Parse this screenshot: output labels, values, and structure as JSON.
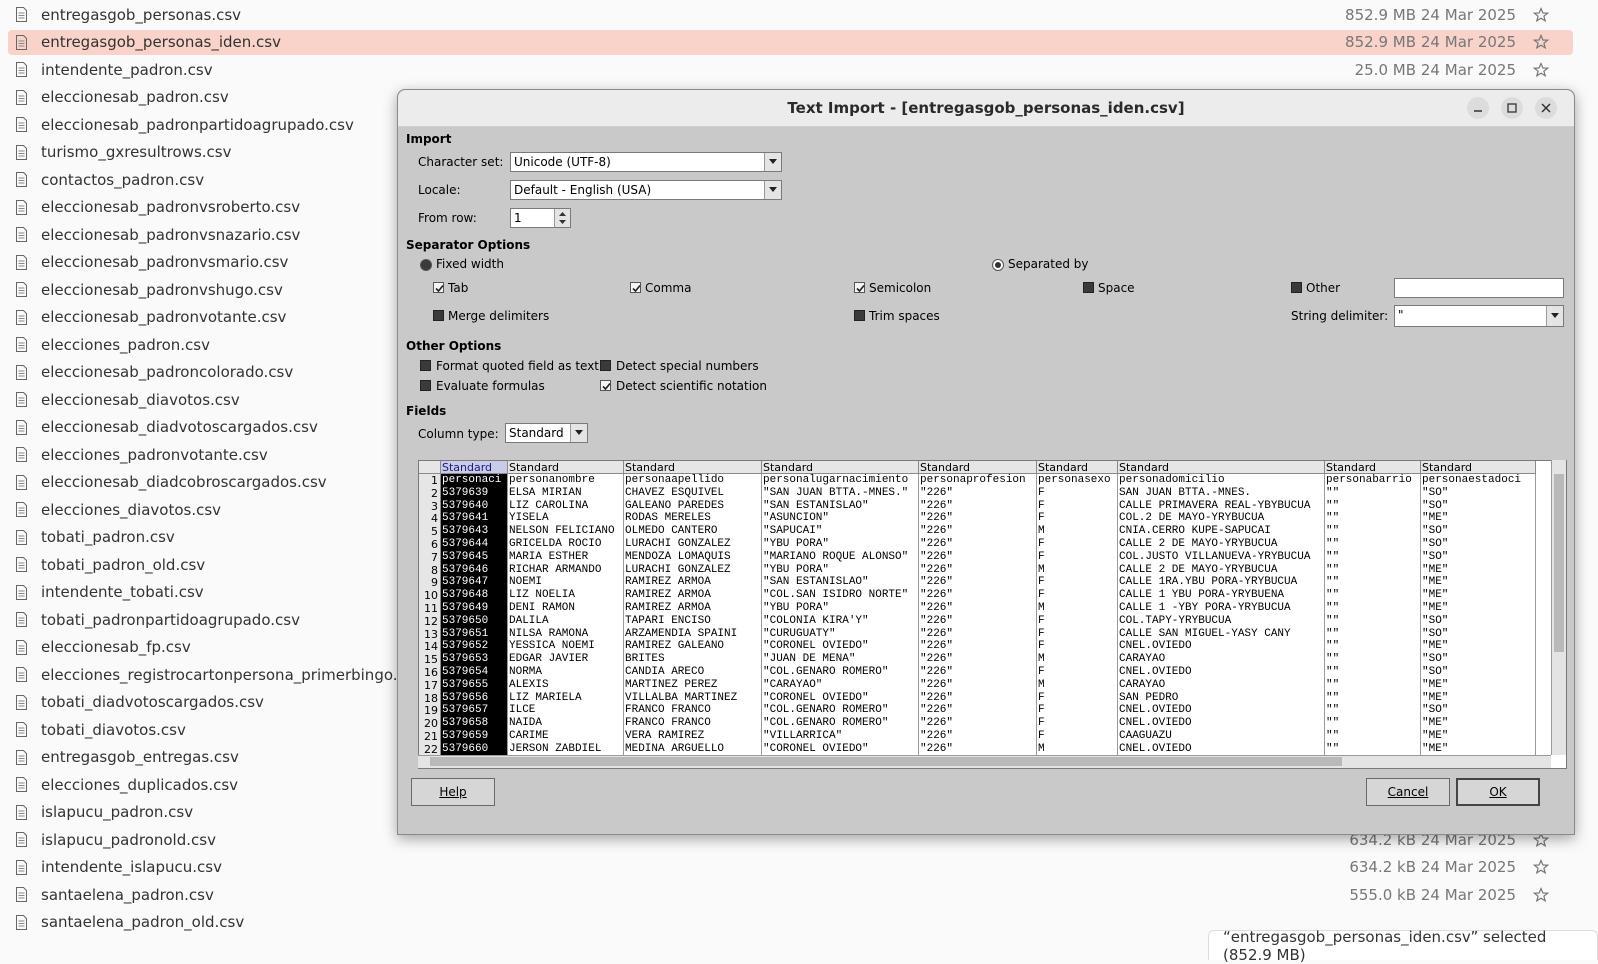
{
  "files": [
    {
      "name": "entregasgob_personas.csv",
      "size": "852.9 MB",
      "date": "24 Mar 2025"
    },
    {
      "name": "entregasgob_personas_iden.csv",
      "size": "852.9 MB",
      "date": "24 Mar 2025",
      "selected": true
    },
    {
      "name": "intendente_padron.csv",
      "size": "25.0 MB",
      "date": "24 Mar 2025"
    },
    {
      "name": "eleccionesab_padron.csv",
      "size": "",
      "date": ""
    },
    {
      "name": "eleccionesab_padronpartidoagrupado.csv",
      "size": "",
      "date": ""
    },
    {
      "name": "turismo_gxresultrows.csv",
      "size": "",
      "date": ""
    },
    {
      "name": "contactos_padron.csv",
      "size": "",
      "date": ""
    },
    {
      "name": "eleccionesab_padronvsroberto.csv",
      "size": "",
      "date": ""
    },
    {
      "name": "eleccionesab_padronvsnazario.csv",
      "size": "",
      "date": ""
    },
    {
      "name": "eleccionesab_padronvsmario.csv",
      "size": "",
      "date": ""
    },
    {
      "name": "eleccionesab_padronvshugo.csv",
      "size": "",
      "date": ""
    },
    {
      "name": "eleccionesab_padronvotante.csv",
      "size": "",
      "date": ""
    },
    {
      "name": "elecciones_padron.csv",
      "size": "",
      "date": ""
    },
    {
      "name": "eleccionesab_padroncolorado.csv",
      "size": "",
      "date": ""
    },
    {
      "name": "eleccionesab_diavotos.csv",
      "size": "",
      "date": ""
    },
    {
      "name": "eleccionesab_diadvotoscargados.csv",
      "size": "",
      "date": ""
    },
    {
      "name": "elecciones_padronvotante.csv",
      "size": "",
      "date": ""
    },
    {
      "name": "eleccionesab_diadcobroscargados.csv",
      "size": "",
      "date": ""
    },
    {
      "name": "elecciones_diavotos.csv",
      "size": "",
      "date": ""
    },
    {
      "name": "tobati_padron.csv",
      "size": "",
      "date": ""
    },
    {
      "name": "tobati_padron_old.csv",
      "size": "",
      "date": ""
    },
    {
      "name": "intendente_tobati.csv",
      "size": "",
      "date": ""
    },
    {
      "name": "tobati_padronpartidoagrupado.csv",
      "size": "",
      "date": ""
    },
    {
      "name": "eleccionesab_fp.csv",
      "size": "",
      "date": ""
    },
    {
      "name": "elecciones_registrocartonpersona_primerbingo.csv",
      "size": "",
      "date": ""
    },
    {
      "name": "tobati_diadvotoscargados.csv",
      "size": "",
      "date": ""
    },
    {
      "name": "tobati_diavotos.csv",
      "size": "",
      "date": ""
    },
    {
      "name": "entregasgob_entregas.csv",
      "size": "",
      "date": ""
    },
    {
      "name": "elecciones_duplicados.csv",
      "size": "",
      "date": ""
    },
    {
      "name": "islapucu_padron.csv",
      "size": "",
      "date": ""
    },
    {
      "name": "islapucu_padronold.csv",
      "size": "634.2 kB",
      "date": "24 Mar 2025"
    },
    {
      "name": "intendente_islapucu.csv",
      "size": "634.2 kB",
      "date": "24 Mar 2025"
    },
    {
      "name": "santaelena_padron.csv",
      "size": "555.0 kB",
      "date": "24 Mar 2025"
    },
    {
      "name": "santaelena_padron_old.csv",
      "size": "",
      "date": ""
    }
  ],
  "toast": "“entregasgob_personas_iden.csv” selected  (852.9 MB)",
  "dialog": {
    "title": "Text Import - [entregasgob_personas_iden.csv]",
    "import_section": "Import",
    "charset_label": "Character set:",
    "charset_value": "Unicode (UTF-8)",
    "locale_label": "Locale:",
    "locale_value": "Default - English (USA)",
    "fromrow_label": "From row:",
    "fromrow_value": "1",
    "separator_section": "Separator Options",
    "fixed_width": "Fixed width",
    "separated_by": "Separated by",
    "tab": "Tab",
    "comma": "Comma",
    "semicolon": "Semicolon",
    "space": "Space",
    "other": "Other",
    "merge_delimiters": "Merge delimiters",
    "trim_spaces": "Trim spaces",
    "string_delimiter_label": "String delimiter:",
    "string_delimiter_value": "\"",
    "other_section": "Other Options",
    "format_quoted": "Format quoted field as text",
    "detect_special": "Detect special numbers",
    "evaluate_formulas": "Evaluate formulas",
    "detect_scientific": "Detect scientific notation",
    "fields_section": "Fields",
    "column_type_label": "Column type:",
    "column_type_value": "Standard",
    "help": "Help",
    "cancel": "Cancel",
    "ok": "OK"
  },
  "preview": {
    "headers": [
      "Standard",
      "Standard",
      "Standard",
      "Standard",
      "Standard",
      "Standard",
      "Standard",
      "Standard",
      "Standard"
    ],
    "rows": [
      [
        "personaci",
        "personanombre",
        "personaapellido",
        "personalugarnacimiento",
        "personaprofesion",
        "personasexo",
        "personadomicilio",
        "personabarrio",
        "personaestadoci"
      ],
      [
        "5379639",
        "ELSA MIRIAN",
        "CHAVEZ ESQUIVEL",
        "\"SAN JUAN BTTA.-MNES.\"",
        "\"226\"",
        "F",
        "SAN JUAN BTTA.-MNES.",
        "\"\"",
        "\"SO\""
      ],
      [
        "5379640",
        "LIZ CAROLINA",
        "GALEANO PAREDES",
        "\"SAN ESTANISLAO\"",
        "\"226\"",
        "F",
        "CALLE PRIMAVERA REAL-YBYBUCUA",
        "\"\"",
        "\"SO\""
      ],
      [
        "5379641",
        "YISELA",
        "RODAS MERELES",
        "\"ASUNCION\"",
        "\"226\"",
        "F",
        "COL.2 DE MAYO-YRYBUCUA",
        "\"\"",
        "\"ME\""
      ],
      [
        "5379643",
        "NELSON FELICIANO",
        "OLMEDO CANTERO",
        "\"SAPUCAI\"",
        "\"226\"",
        "M",
        "CNIA.CERRO KUPE-SAPUCAI",
        "\"\"",
        "\"SO\""
      ],
      [
        "5379644",
        "GRICELDA ROCIO",
        "LURACHI GONZALEZ",
        "\"YBU PORA\"",
        "\"226\"",
        "F",
        "CALLE 2 DE MAYO-YRYBUCUA",
        "\"\"",
        "\"SO\""
      ],
      [
        "5379645",
        "MARIA ESTHER",
        "MENDOZA LOMAQUIS",
        "\"MARIANO ROQUE ALONSO\"",
        "\"226\"",
        "F",
        "COL.JUSTO VILLANUEVA-YRYBUCUA",
        "\"\"",
        "\"SO\""
      ],
      [
        "5379646",
        "RICHAR ARMANDO",
        "LURACHI GONZALEZ",
        "\"YBU PORA\"",
        "\"226\"",
        "M",
        "CALLE 2 DE MAYO-YRYBUCUA",
        "\"\"",
        "\"ME\""
      ],
      [
        "5379647",
        "NOEMI",
        "RAMIREZ ARMOA",
        "\"SAN ESTANISLAO\"",
        "\"226\"",
        "F",
        "CALLE 1RA.YBU PORA-YRYBUCUA",
        "\"\"",
        "\"ME\""
      ],
      [
        "5379648",
        "LIZ NOELIA",
        "RAMIREZ ARMOA",
        "\"COL.SAN ISIDRO NORTE\"",
        "\"226\"",
        "F",
        "CALLE 1 YBU PORA-YRYBUENA",
        "\"\"",
        "\"ME\""
      ],
      [
        "5379649",
        "DENI RAMON",
        "RAMIREZ ARMOA",
        "\"YBU PORA\"",
        "\"226\"",
        "M",
        "CALLE 1 -YBY PORA-YRYBUCUA",
        "\"\"",
        "\"ME\""
      ],
      [
        "5379650",
        "DALILA",
        "TAPARI ENCISO",
        "\"COLONIA KIRA'Y\"",
        "\"226\"",
        "F",
        "COL.TAPY-YRYBUCUA",
        "\"\"",
        "\"SO\""
      ],
      [
        "5379651",
        "NILSA RAMONA",
        "ARZAMENDIA SPAINI",
        "\"CURUGUATY\"",
        "\"226\"",
        "F",
        "CALLE SAN MIGUEL-YASY CAÑY",
        "\"\"",
        "\"SO\""
      ],
      [
        "5379652",
        "YESSICA NOEMI",
        "RAMIREZ GALEANO",
        "\"CORONEL OVIEDO\"",
        "\"226\"",
        "F",
        "CNEL.OVIEDO",
        "\"\"",
        "\"ME\""
      ],
      [
        "5379653",
        "EDGAR JAVIER",
        "BRITES",
        "\"JUAN DE MENA\"",
        "\"226\"",
        "M",
        "CARAYAO",
        "\"\"",
        "\"SO\""
      ],
      [
        "5379654",
        "NORMA",
        "CANDIA ARECO",
        "\"COL.GENARO ROMERO\"",
        "\"226\"",
        "F",
        "CNEL.OVIEDO",
        "\"\"",
        "\"SO\""
      ],
      [
        "5379655",
        "ALEXIS",
        "MARTINEZ PEREZ",
        "\"CARAYAO\"",
        "\"226\"",
        "M",
        "CARAYAO",
        "\"\"",
        "\"ME\""
      ],
      [
        "5379656",
        "LIZ MARIELA",
        "VILLALBA MARTINEZ",
        "\"CORONEL OVIEDO\"",
        "\"226\"",
        "F",
        "SAN PEDRO",
        "\"\"",
        "\"ME\""
      ],
      [
        "5379657",
        "ILCE",
        "FRANCO FRANCO",
        "\"COL.GENARO ROMERO\"",
        "\"226\"",
        "F",
        "CNEL.OVIEDO",
        "\"\"",
        "\"SO\""
      ],
      [
        "5379658",
        "NAIDA",
        "FRANCO FRANCO",
        "\"COL.GENARO ROMERO\"",
        "\"226\"",
        "F",
        "CNEL.OVIEDO",
        "\"\"",
        "\"ME\""
      ],
      [
        "5379659",
        "CARIME",
        "VERA RAMIREZ",
        "\"VILLARRICA\"",
        "\"226\"",
        "F",
        "CAAGUAZU",
        "\"\"",
        "\"ME\""
      ],
      [
        "5379660",
        "JERSON ZABDIEL",
        "MEDINA ARGUELLO",
        "\"CORONEL OVIEDO\"",
        "\"226\"",
        "M",
        "CNEL.OVIEDO",
        "\"\"",
        "\"ME\""
      ]
    ]
  }
}
